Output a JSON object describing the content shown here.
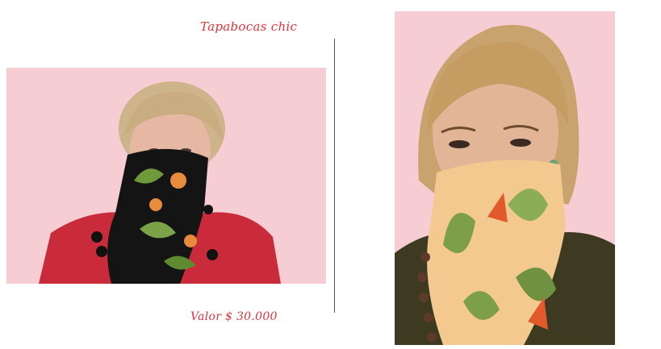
{
  "header": {
    "title": "Tapabocas chic"
  },
  "footer": {
    "price": "Valor $ 30.000"
  },
  "photos": [
    {
      "subject": "woman-short-hair-black-tropical-mask"
    },
    {
      "subject": "woman-blonde-peach-tropical-mask"
    }
  ],
  "colors": {
    "accent": "#e0303a",
    "backdrop": "#f5c9cf"
  }
}
